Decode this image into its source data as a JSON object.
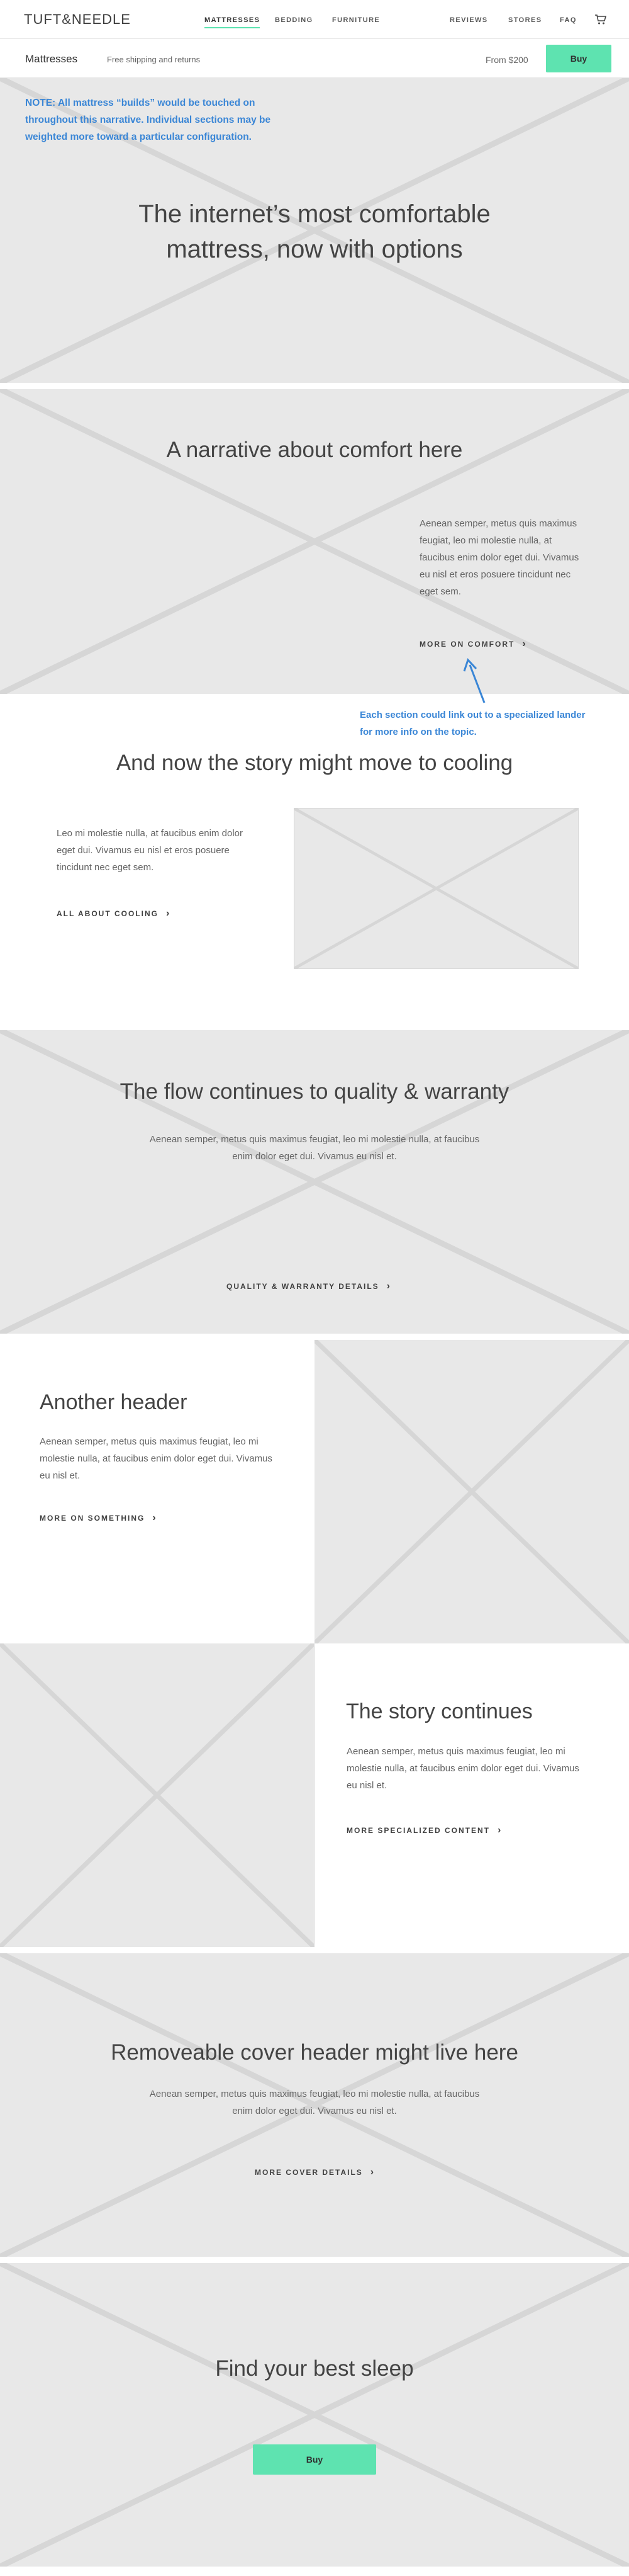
{
  "nav": {
    "logo": "TUFT&NEEDLE",
    "links": [
      "MATTRESSES",
      "BEDDING",
      "FURNITURE"
    ],
    "right_links": [
      "REVIEWS",
      "STORES",
      "FAQ"
    ],
    "cart_icon": "cart-icon",
    "accent_color": "#5ee3b0"
  },
  "subnav": {
    "title": "Mattresses",
    "shipping": "Free shipping and returns",
    "price": "From $200",
    "buy_label": "Buy"
  },
  "note": "NOTE: All mattress “builds” would be touched on throughout this narrative. Individual sections may be weighted more toward a particular configuration.",
  "hero": {
    "title_line1": "The internet’s most comfortable",
    "title_line2": "mattress, now with options"
  },
  "comfort": {
    "title": "A narrative about comfort here",
    "body": "Aenean semper, metus quis maximus feugiat, leo mi molestie nulla, at faucibus enim dolor eget dui. Vivamus eu nisl et eros posuere tincidunt nec eget sem.",
    "cta": "MORE ON COMFORT"
  },
  "annotation": "Each section could link out to a specialized lander for more info on the topic.",
  "cooling": {
    "title": "And now the story might move to cooling",
    "body": "Leo mi molestie nulla, at faucibus enim dolor eget dui. Vivamus eu nisl et eros posuere tincidunt nec eget sem.",
    "cta": "ALL ABOUT COOLING"
  },
  "quality": {
    "title": "The flow continues to quality & warranty",
    "body": "Aenean semper, metus quis maximus feugiat, leo mi molestie nulla, at faucibus enim dolor eget dui. Vivamus eu nisl et.",
    "cta": "QUALITY & WARRANTY DETAILS"
  },
  "another": {
    "title": "Another header",
    "body": "Aenean semper, metus quis maximus feugiat, leo mi molestie nulla, at faucibus enim dolor eget dui. Vivamus eu nisl et.",
    "cta": "MORE ON SOMETHING"
  },
  "story": {
    "title": "The story continues",
    "body": "Aenean semper, metus quis maximus feugiat, leo mi molestie nulla, at faucibus enim dolor eget dui. Vivamus eu nisl et.",
    "cta": "MORE SPECIALIZED CONTENT"
  },
  "cover": {
    "title": "Removeable cover header might live here",
    "body": "Aenean semper, metus quis maximus feugiat, leo mi molestie nulla, at faucibus enim dolor eget dui. Vivamus eu nisl et.",
    "cta": "MORE COVER DETAILS"
  },
  "find": {
    "title": "Find your best sleep",
    "buy_label": "Buy"
  }
}
